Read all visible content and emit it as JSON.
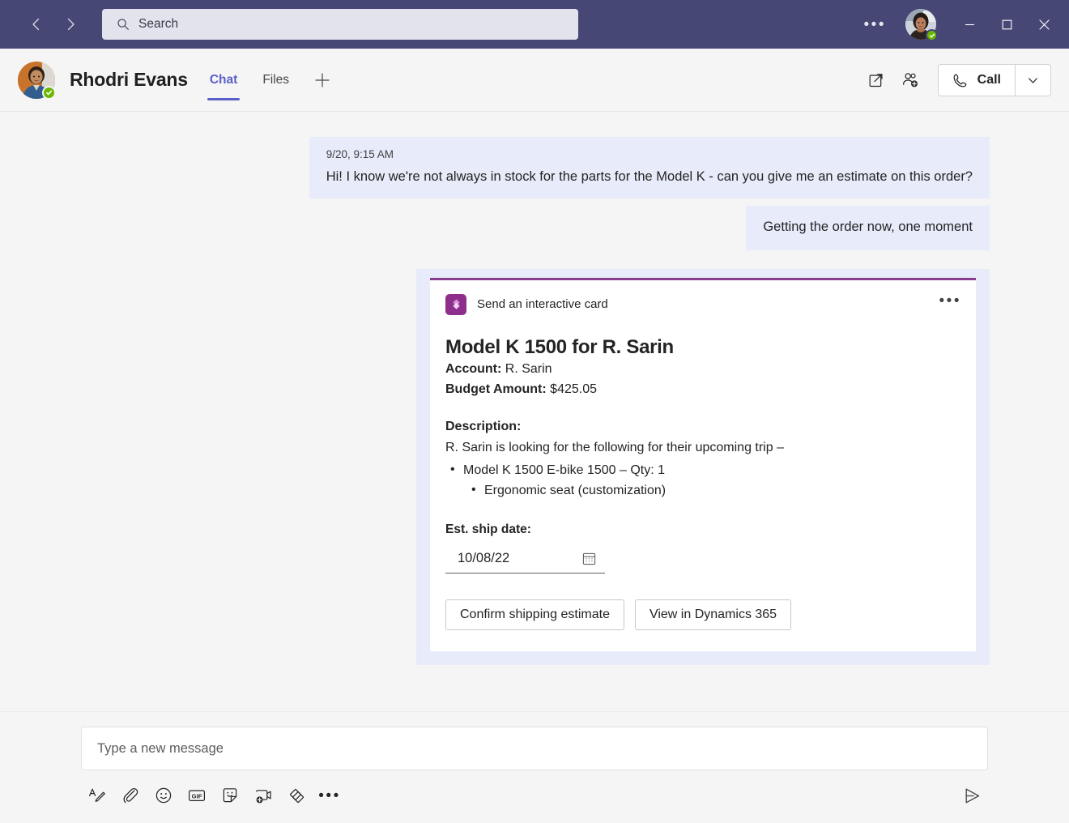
{
  "titlebar": {
    "back_icon": "chevron-left-icon",
    "forward_icon": "chevron-right-icon",
    "search_placeholder": "Search",
    "search_icon": "search-icon",
    "more_label": "•••",
    "minimize_label": "minimize-icon",
    "maximize_label": "maximize-icon",
    "close_label": "close-icon",
    "background_color": "#464775",
    "search_background": "#e3e3ee"
  },
  "chat_header": {
    "contact_name": "Rhodri Evans",
    "presence": "available",
    "presence_color": "#6bb700",
    "tabs": [
      {
        "label": "Chat",
        "active": true
      },
      {
        "label": "Files",
        "active": false
      }
    ],
    "add_tab_icon": "plus-icon",
    "popout_icon": "popout-icon",
    "add_people_icon": "add-person-icon",
    "call_label": "Call",
    "call_icon": "phone-icon",
    "call_dropdown_icon": "chevron-down-icon",
    "accent_color": "#5b5fc7"
  },
  "messages": [
    {
      "time": "9/20, 9:15 AM",
      "text": "Hi! I know we're not always in stock for the parts for the Model K - can you give me an estimate on this order?",
      "side": "left"
    },
    {
      "time": "",
      "text": "Getting the order now, one moment",
      "side": "right"
    }
  ],
  "card": {
    "app_icon": "power-automate-icon",
    "header_label": "Send an interactive card",
    "more_label": "•••",
    "title": "Model K 1500 for R. Sarin",
    "fields": [
      {
        "label": "Account:",
        "value": "R. Sarin"
      },
      {
        "label": "Budget Amount:",
        "value": "$425.05"
      }
    ],
    "description_label": "Description:",
    "description_text": "R. Sarin is looking for the following for their upcoming trip –",
    "bullets": [
      {
        "text": "Model K 1500 E-bike 1500 – Qty: 1",
        "level": 1
      },
      {
        "text": "Ergonomic seat (customization)",
        "level": 2
      }
    ],
    "date_label": "Est. ship date:",
    "date_value": "10/08/22",
    "date_icon": "calendar-icon",
    "actions": [
      {
        "label": "Confirm shipping estimate"
      },
      {
        "label": "View in Dynamics 365"
      }
    ],
    "accent_color": "#8a3d8f",
    "bubble_color": "#e8ebfa"
  },
  "compose": {
    "placeholder": "Type a new message",
    "tools": [
      {
        "name": "format-icon"
      },
      {
        "name": "attach-icon"
      },
      {
        "name": "emoji-icon"
      },
      {
        "name": "gif-icon"
      },
      {
        "name": "sticker-icon"
      },
      {
        "name": "meet-now-icon"
      },
      {
        "name": "apps-icon"
      }
    ],
    "more_label": "•••",
    "send_icon": "send-icon"
  }
}
